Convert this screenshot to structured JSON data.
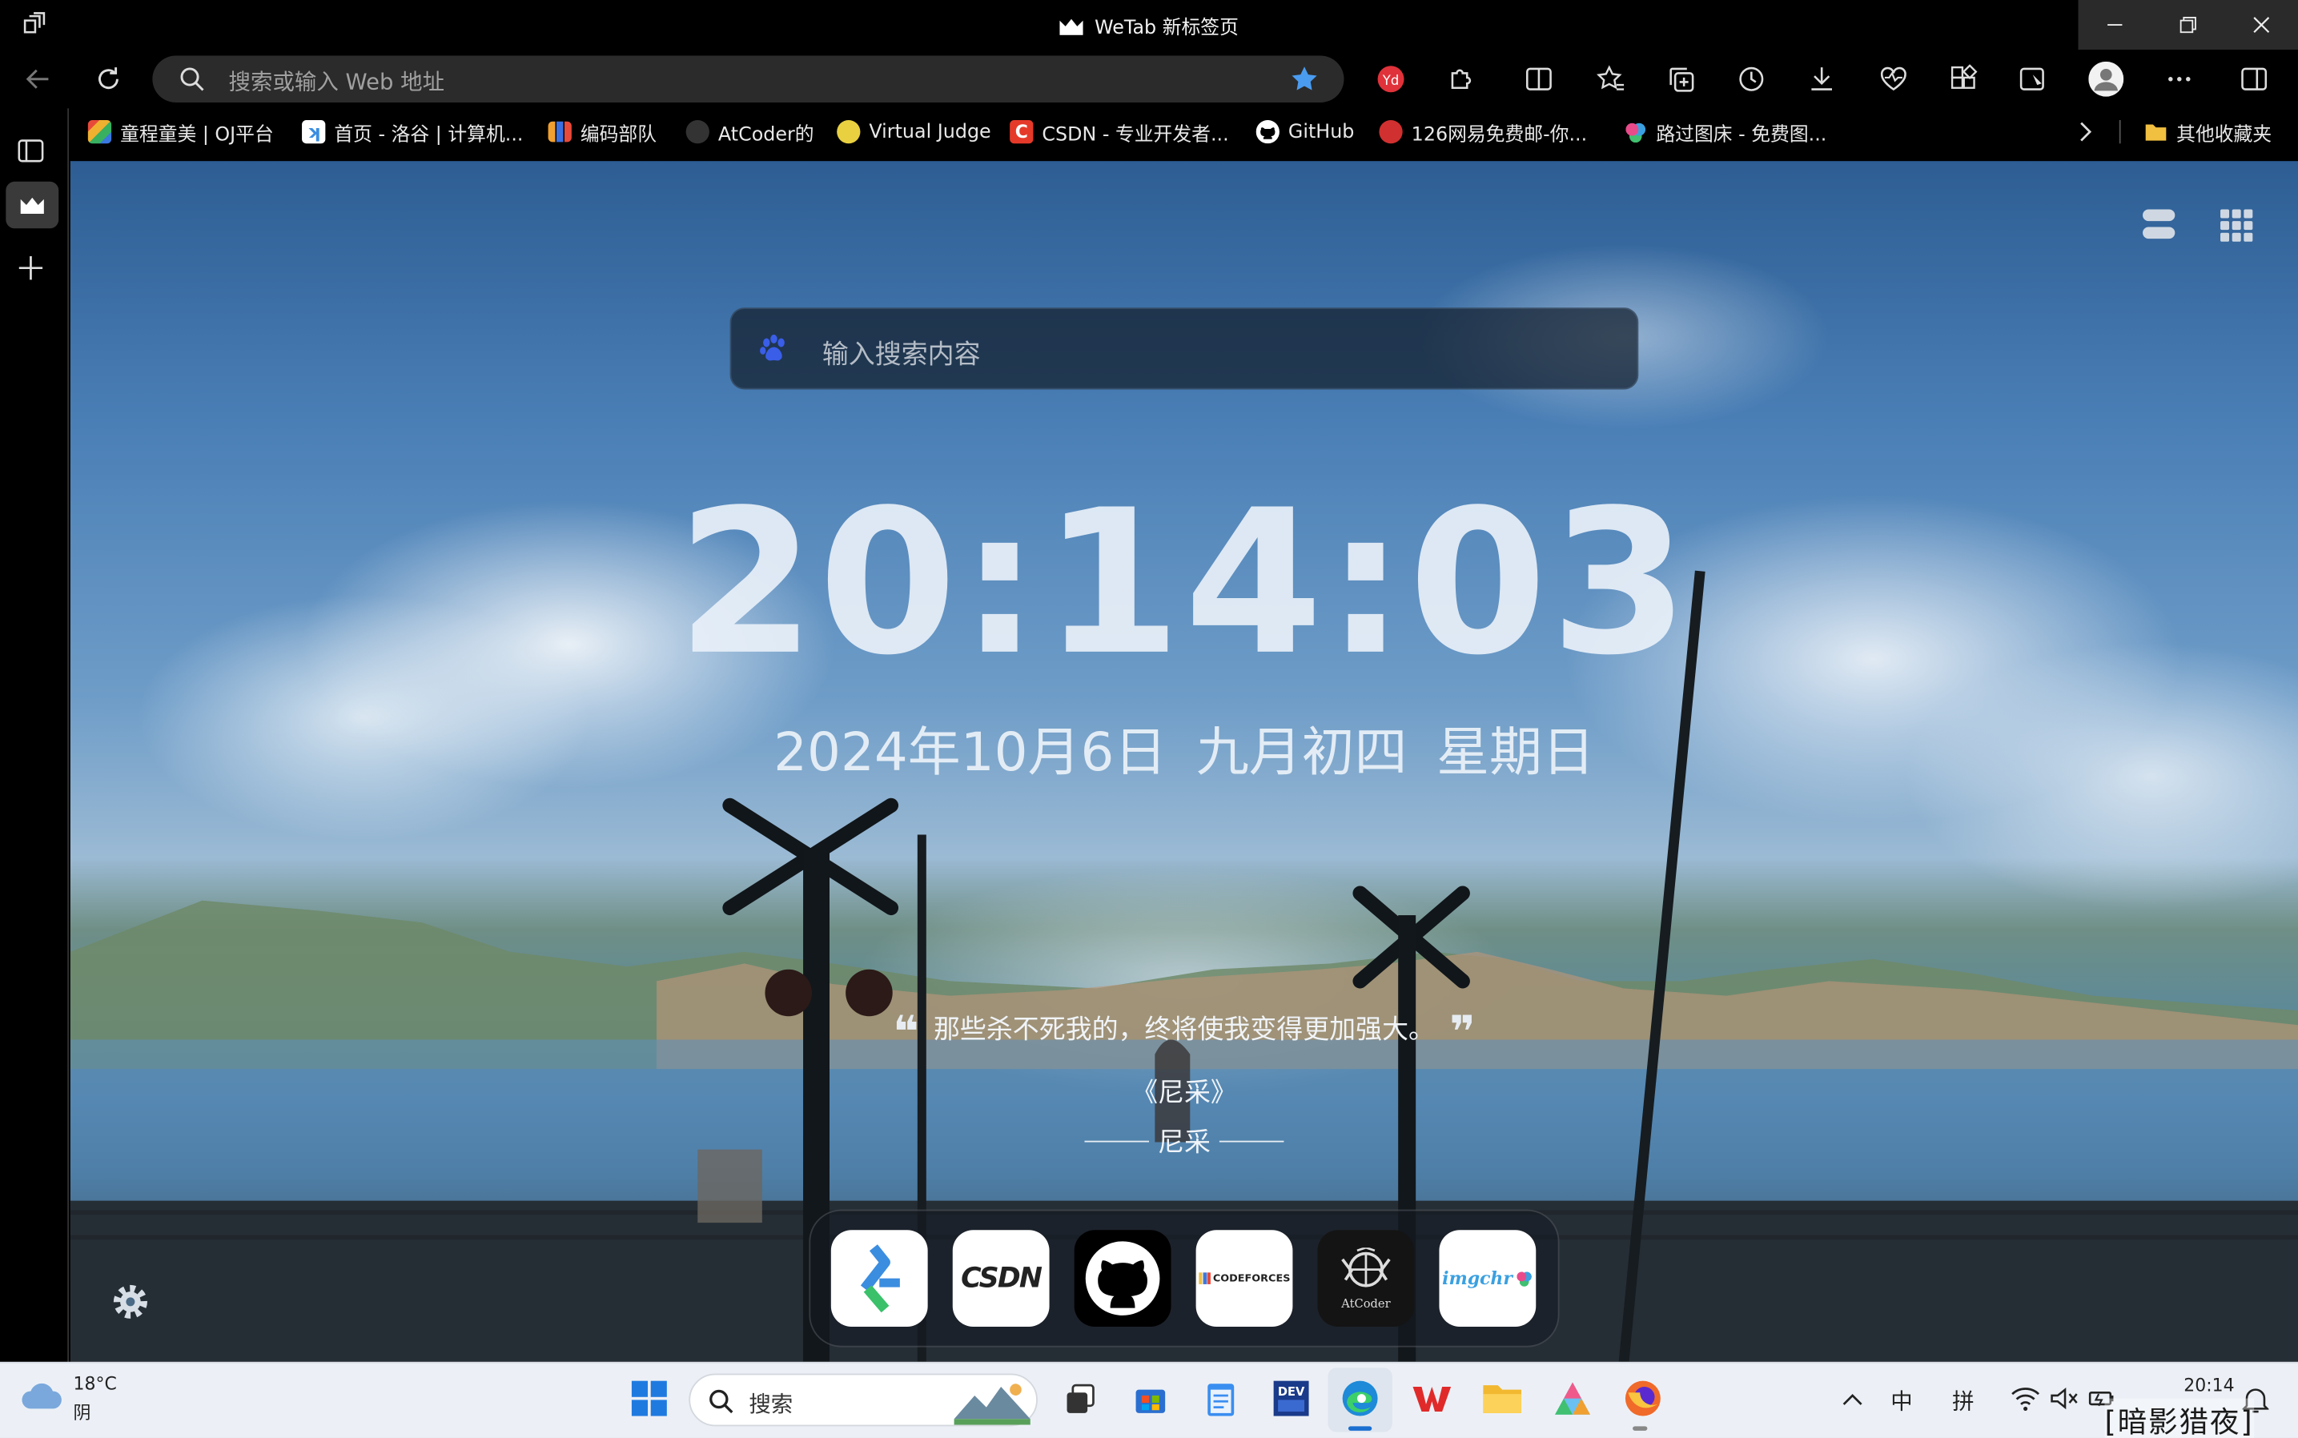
{
  "browser": {
    "tab_title": "WeTab 新标签页",
    "address_placeholder": "搜索或输入 Web 地址",
    "bookmarks": [
      {
        "label": "童程童美 | OJ平台",
        "icon": "rainbow-grid-icon",
        "color": "#e8a33a"
      },
      {
        "label": "首页 - 洛谷 | 计算机...",
        "icon": "luogu-icon",
        "color": "#3b8de0"
      },
      {
        "label": "编码部队",
        "icon": "bar-chart-icon",
        "color": "#f0a030"
      },
      {
        "label": "AtCoder的",
        "icon": "atcoder-icon",
        "color": "#555555"
      },
      {
        "label": "Virtual Judge",
        "icon": "vjudge-icon",
        "color": "#e8d040"
      },
      {
        "label": "CSDN - 专业开发者...",
        "icon": "csdn-icon",
        "color": "#e53a2a"
      },
      {
        "label": "GitHub",
        "icon": "github-icon",
        "color": "#ffffff"
      },
      {
        "label": "126网易免费邮-你...",
        "icon": "netease-icon",
        "color": "#d03030"
      },
      {
        "label": "路过图床 - 免费图...",
        "icon": "imgchr-icon",
        "color": "#8a5ad0"
      }
    ],
    "other_favorites": "其他收藏夹"
  },
  "newtab": {
    "search_placeholder": "输入搜索内容",
    "time": "20:14:03",
    "date_gregorian": "2024年10月6日",
    "date_lunar": "九月初四",
    "weekday": "星期日",
    "quote": "那些杀不死我的，终将使我变得更加强大。",
    "quote_source": "《尼采》",
    "quote_author": "尼采",
    "dock": [
      {
        "name": "luogu",
        "label": ""
      },
      {
        "name": "csdn",
        "label": "CSDN"
      },
      {
        "name": "github",
        "label": ""
      },
      {
        "name": "codeforces",
        "label": "CODEFORCES"
      },
      {
        "name": "atcoder",
        "label": "AtCoder"
      },
      {
        "name": "imgchr",
        "label": "imgchr"
      }
    ]
  },
  "taskbar": {
    "weather_temp": "18°C",
    "weather_desc": "阴",
    "search_label": "搜索",
    "ime_lang": "中",
    "ime_mode": "拼",
    "clock": "20:14",
    "watermark": "[暗影猎夜]"
  },
  "colors": {
    "accent_blue": "#3b8de0",
    "taskbar_bg": "#ecf0f6",
    "titlebar_bg": "#000000"
  }
}
